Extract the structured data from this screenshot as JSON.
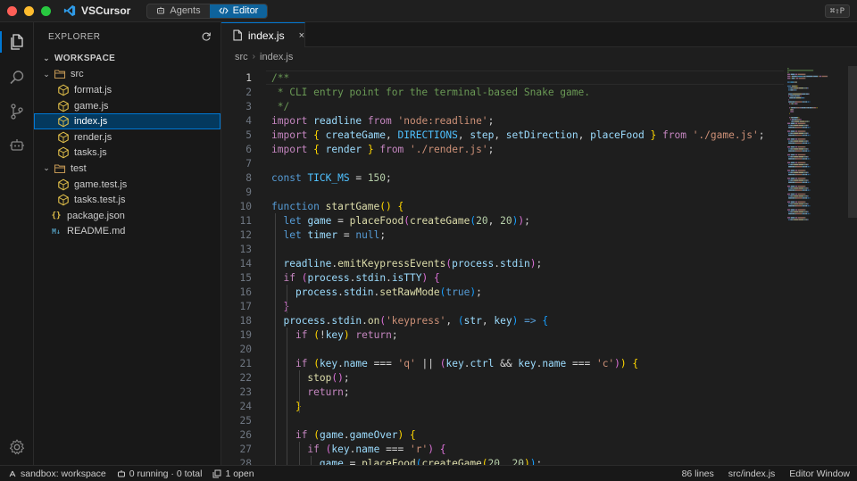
{
  "titlebar": {
    "app_title": "VSCursor",
    "modes": [
      {
        "label": "Agents",
        "active": false
      },
      {
        "label": "Editor",
        "active": true
      }
    ],
    "shortcut_badge": "⌘⇧P"
  },
  "activitybar": {
    "items": [
      "explorer-icon",
      "search-icon",
      "source-control-icon",
      "agent-icon"
    ],
    "bottom": "settings-icon"
  },
  "sidebar": {
    "title": "EXPLORER",
    "refresh_icon": "refresh-icon",
    "workspace": "WORKSPACE",
    "items": [
      {
        "label": "src",
        "type": "folder"
      },
      {
        "label": "format.js",
        "type": "js"
      },
      {
        "label": "game.js",
        "type": "js"
      },
      {
        "label": "index.js",
        "type": "js"
      },
      {
        "label": "render.js",
        "type": "js"
      },
      {
        "label": "tasks.js",
        "type": "js"
      },
      {
        "label": "test",
        "type": "folder"
      },
      {
        "label": "game.test.js",
        "type": "js"
      },
      {
        "label": "tasks.test.js",
        "type": "js"
      },
      {
        "label": "package.json",
        "type": "json",
        "glyph": "{}"
      },
      {
        "label": "README.md",
        "type": "md",
        "glyph": "M↓"
      }
    ]
  },
  "editor": {
    "tab_label": "index.js",
    "tab_close": "×",
    "breadcrumb": [
      "src",
      "index.js"
    ],
    "breadcrumb_sep": "›",
    "current_line": 1,
    "lines": [
      {
        "n": "1",
        "t": [
          [
            "c-com",
            "/**"
          ]
        ]
      },
      {
        "n": "2",
        "t": [
          [
            "c-com",
            " * CLI entry point for the terminal-based Snake game."
          ]
        ]
      },
      {
        "n": "3",
        "t": [
          [
            "c-com",
            " */"
          ]
        ]
      },
      {
        "n": "4",
        "t": [
          [
            "c-kw",
            "import"
          ],
          [
            "c-txt",
            " "
          ],
          [
            "c-var",
            "readline"
          ],
          [
            "c-txt",
            " "
          ],
          [
            "c-kw",
            "from"
          ],
          [
            "c-txt",
            " "
          ],
          [
            "c-str",
            "'node:readline'"
          ],
          [
            "c-txt",
            ";"
          ]
        ]
      },
      {
        "n": "5",
        "t": [
          [
            "c-kw",
            "import"
          ],
          [
            "c-txt",
            " "
          ],
          [
            "c-p1",
            "{"
          ],
          [
            "c-txt",
            " "
          ],
          [
            "c-var",
            "createGame"
          ],
          [
            "c-txt",
            ", "
          ],
          [
            "c-const",
            "DIRECTIONS"
          ],
          [
            "c-txt",
            ", "
          ],
          [
            "c-var",
            "step"
          ],
          [
            "c-txt",
            ", "
          ],
          [
            "c-var",
            "setDirection"
          ],
          [
            "c-txt",
            ", "
          ],
          [
            "c-var",
            "placeFood"
          ],
          [
            "c-txt",
            " "
          ],
          [
            "c-p1",
            "}"
          ],
          [
            "c-txt",
            " "
          ],
          [
            "c-kw",
            "from"
          ],
          [
            "c-txt",
            " "
          ],
          [
            "c-str",
            "'./game.js'"
          ],
          [
            "c-txt",
            ";"
          ]
        ]
      },
      {
        "n": "6",
        "t": [
          [
            "c-kw",
            "import"
          ],
          [
            "c-txt",
            " "
          ],
          [
            "c-p1",
            "{"
          ],
          [
            "c-txt",
            " "
          ],
          [
            "c-var",
            "render"
          ],
          [
            "c-txt",
            " "
          ],
          [
            "c-p1",
            "}"
          ],
          [
            "c-txt",
            " "
          ],
          [
            "c-kw",
            "from"
          ],
          [
            "c-txt",
            " "
          ],
          [
            "c-str",
            "'./render.js'"
          ],
          [
            "c-txt",
            ";"
          ]
        ]
      },
      {
        "n": "7",
        "t": []
      },
      {
        "n": "8",
        "t": [
          [
            "c-dec",
            "const"
          ],
          [
            "c-txt",
            " "
          ],
          [
            "c-const",
            "TICK_MS"
          ],
          [
            "c-txt",
            " = "
          ],
          [
            "c-num",
            "150"
          ],
          [
            "c-txt",
            ";"
          ]
        ]
      },
      {
        "n": "9",
        "t": []
      },
      {
        "n": "10",
        "t": [
          [
            "c-dec",
            "function"
          ],
          [
            "c-txt",
            " "
          ],
          [
            "c-fn",
            "startGame"
          ],
          [
            "c-p1",
            "()"
          ],
          [
            "c-txt",
            " "
          ],
          [
            "c-p1",
            "{"
          ]
        ]
      },
      {
        "n": "11",
        "t": [
          [
            "c-txt",
            "  "
          ],
          [
            "c-dec",
            "let"
          ],
          [
            "c-txt",
            " "
          ],
          [
            "c-var",
            "game"
          ],
          [
            "c-txt",
            " = "
          ],
          [
            "c-fn",
            "placeFood"
          ],
          [
            "c-p2",
            "("
          ],
          [
            "c-fn",
            "createGame"
          ],
          [
            "c-p3",
            "("
          ],
          [
            "c-num",
            "20"
          ],
          [
            "c-txt",
            ", "
          ],
          [
            "c-num",
            "20"
          ],
          [
            "c-p3",
            ")"
          ],
          [
            "c-p2",
            ")"
          ],
          [
            "c-txt",
            ";"
          ]
        ]
      },
      {
        "n": "12",
        "t": [
          [
            "c-txt",
            "  "
          ],
          [
            "c-dec",
            "let"
          ],
          [
            "c-txt",
            " "
          ],
          [
            "c-var",
            "timer"
          ],
          [
            "c-txt",
            " = "
          ],
          [
            "c-dec",
            "null"
          ],
          [
            "c-txt",
            ";"
          ]
        ]
      },
      {
        "n": "13",
        "t": []
      },
      {
        "n": "14",
        "t": [
          [
            "c-txt",
            "  "
          ],
          [
            "c-var",
            "readline"
          ],
          [
            "c-txt",
            "."
          ],
          [
            "c-fn",
            "emitKeypressEvents"
          ],
          [
            "c-p2",
            "("
          ],
          [
            "c-var",
            "process"
          ],
          [
            "c-txt",
            "."
          ],
          [
            "c-var",
            "stdin"
          ],
          [
            "c-p2",
            ")"
          ],
          [
            "c-txt",
            ";"
          ]
        ]
      },
      {
        "n": "15",
        "t": [
          [
            "c-txt",
            "  "
          ],
          [
            "c-kw",
            "if"
          ],
          [
            "c-txt",
            " "
          ],
          [
            "c-p2",
            "("
          ],
          [
            "c-var",
            "process"
          ],
          [
            "c-txt",
            "."
          ],
          [
            "c-var",
            "stdin"
          ],
          [
            "c-txt",
            "."
          ],
          [
            "c-var",
            "isTTY"
          ],
          [
            "c-p2",
            ")"
          ],
          [
            "c-txt",
            " "
          ],
          [
            "c-p2",
            "{"
          ]
        ]
      },
      {
        "n": "16",
        "t": [
          [
            "c-txt",
            "    "
          ],
          [
            "c-var",
            "process"
          ],
          [
            "c-txt",
            "."
          ],
          [
            "c-var",
            "stdin"
          ],
          [
            "c-txt",
            "."
          ],
          [
            "c-fn",
            "setRawMode"
          ],
          [
            "c-p3",
            "("
          ],
          [
            "c-dec",
            "true"
          ],
          [
            "c-p3",
            ")"
          ],
          [
            "c-txt",
            ";"
          ]
        ]
      },
      {
        "n": "17",
        "t": [
          [
            "c-txt",
            "  "
          ],
          [
            "c-p2",
            "}"
          ]
        ]
      },
      {
        "n": "18",
        "t": [
          [
            "c-txt",
            "  "
          ],
          [
            "c-var",
            "process"
          ],
          [
            "c-txt",
            "."
          ],
          [
            "c-var",
            "stdin"
          ],
          [
            "c-txt",
            "."
          ],
          [
            "c-fn",
            "on"
          ],
          [
            "c-p2",
            "("
          ],
          [
            "c-str",
            "'keypress'"
          ],
          [
            "c-txt",
            ", "
          ],
          [
            "c-p3",
            "("
          ],
          [
            "c-var",
            "str"
          ],
          [
            "c-txt",
            ", "
          ],
          [
            "c-var",
            "key"
          ],
          [
            "c-p3",
            ")"
          ],
          [
            "c-txt",
            " "
          ],
          [
            "c-dec",
            "=>"
          ],
          [
            "c-txt",
            " "
          ],
          [
            "c-p3",
            "{"
          ]
        ]
      },
      {
        "n": "19",
        "t": [
          [
            "c-txt",
            "    "
          ],
          [
            "c-kw",
            "if"
          ],
          [
            "c-txt",
            " "
          ],
          [
            "c-p1",
            "("
          ],
          [
            "c-txt",
            "!"
          ],
          [
            "c-var",
            "key"
          ],
          [
            "c-p1",
            ")"
          ],
          [
            "c-txt",
            " "
          ],
          [
            "c-kw",
            "return"
          ],
          [
            "c-txt",
            ";"
          ]
        ]
      },
      {
        "n": "20",
        "t": []
      },
      {
        "n": "21",
        "t": [
          [
            "c-txt",
            "    "
          ],
          [
            "c-kw",
            "if"
          ],
          [
            "c-txt",
            " "
          ],
          [
            "c-p1",
            "("
          ],
          [
            "c-var",
            "key"
          ],
          [
            "c-txt",
            "."
          ],
          [
            "c-var",
            "name"
          ],
          [
            "c-txt",
            " === "
          ],
          [
            "c-str",
            "'q'"
          ],
          [
            "c-txt",
            " || "
          ],
          [
            "c-p2",
            "("
          ],
          [
            "c-var",
            "key"
          ],
          [
            "c-txt",
            "."
          ],
          [
            "c-var",
            "ctrl"
          ],
          [
            "c-txt",
            " && "
          ],
          [
            "c-var",
            "key"
          ],
          [
            "c-txt",
            "."
          ],
          [
            "c-var",
            "name"
          ],
          [
            "c-txt",
            " === "
          ],
          [
            "c-str",
            "'c'"
          ],
          [
            "c-p2",
            ")"
          ],
          [
            "c-p1",
            ")"
          ],
          [
            "c-txt",
            " "
          ],
          [
            "c-p1",
            "{"
          ]
        ]
      },
      {
        "n": "22",
        "t": [
          [
            "c-txt",
            "      "
          ],
          [
            "c-fn",
            "stop"
          ],
          [
            "c-p2",
            "()"
          ],
          [
            "c-txt",
            ";"
          ]
        ]
      },
      {
        "n": "23",
        "t": [
          [
            "c-txt",
            "      "
          ],
          [
            "c-kw",
            "return"
          ],
          [
            "c-txt",
            ";"
          ]
        ]
      },
      {
        "n": "24",
        "t": [
          [
            "c-txt",
            "    "
          ],
          [
            "c-p1",
            "}"
          ]
        ]
      },
      {
        "n": "25",
        "t": []
      },
      {
        "n": "26",
        "t": [
          [
            "c-txt",
            "    "
          ],
          [
            "c-kw",
            "if"
          ],
          [
            "c-txt",
            " "
          ],
          [
            "c-p1",
            "("
          ],
          [
            "c-var",
            "game"
          ],
          [
            "c-txt",
            "."
          ],
          [
            "c-var",
            "gameOver"
          ],
          [
            "c-p1",
            ")"
          ],
          [
            "c-txt",
            " "
          ],
          [
            "c-p1",
            "{"
          ]
        ]
      },
      {
        "n": "27",
        "t": [
          [
            "c-txt",
            "      "
          ],
          [
            "c-kw",
            "if"
          ],
          [
            "c-txt",
            " "
          ],
          [
            "c-p2",
            "("
          ],
          [
            "c-var",
            "key"
          ],
          [
            "c-txt",
            "."
          ],
          [
            "c-var",
            "name"
          ],
          [
            "c-txt",
            " === "
          ],
          [
            "c-str",
            "'r'"
          ],
          [
            "c-p2",
            ")"
          ],
          [
            "c-txt",
            " "
          ],
          [
            "c-p2",
            "{"
          ]
        ]
      },
      {
        "n": "28",
        "t": [
          [
            "c-txt",
            "        "
          ],
          [
            "c-var",
            "game"
          ],
          [
            "c-txt",
            " = "
          ],
          [
            "c-fn",
            "placeFood"
          ],
          [
            "c-p3",
            "("
          ],
          [
            "c-fn",
            "createGame"
          ],
          [
            "c-p1",
            "("
          ],
          [
            "c-num",
            "20"
          ],
          [
            "c-txt",
            ", "
          ],
          [
            "c-num",
            "20"
          ],
          [
            "c-p1",
            ")"
          ],
          [
            "c-p3",
            ")"
          ],
          [
            "c-txt",
            ";"
          ]
        ]
      }
    ]
  },
  "statusbar": {
    "sandbox": "sandbox: workspace",
    "running": "0 running · 0 total",
    "open": "1 open",
    "line_count": "86 lines",
    "file_path": "src/index.js",
    "window_mode": "Editor Window"
  }
}
